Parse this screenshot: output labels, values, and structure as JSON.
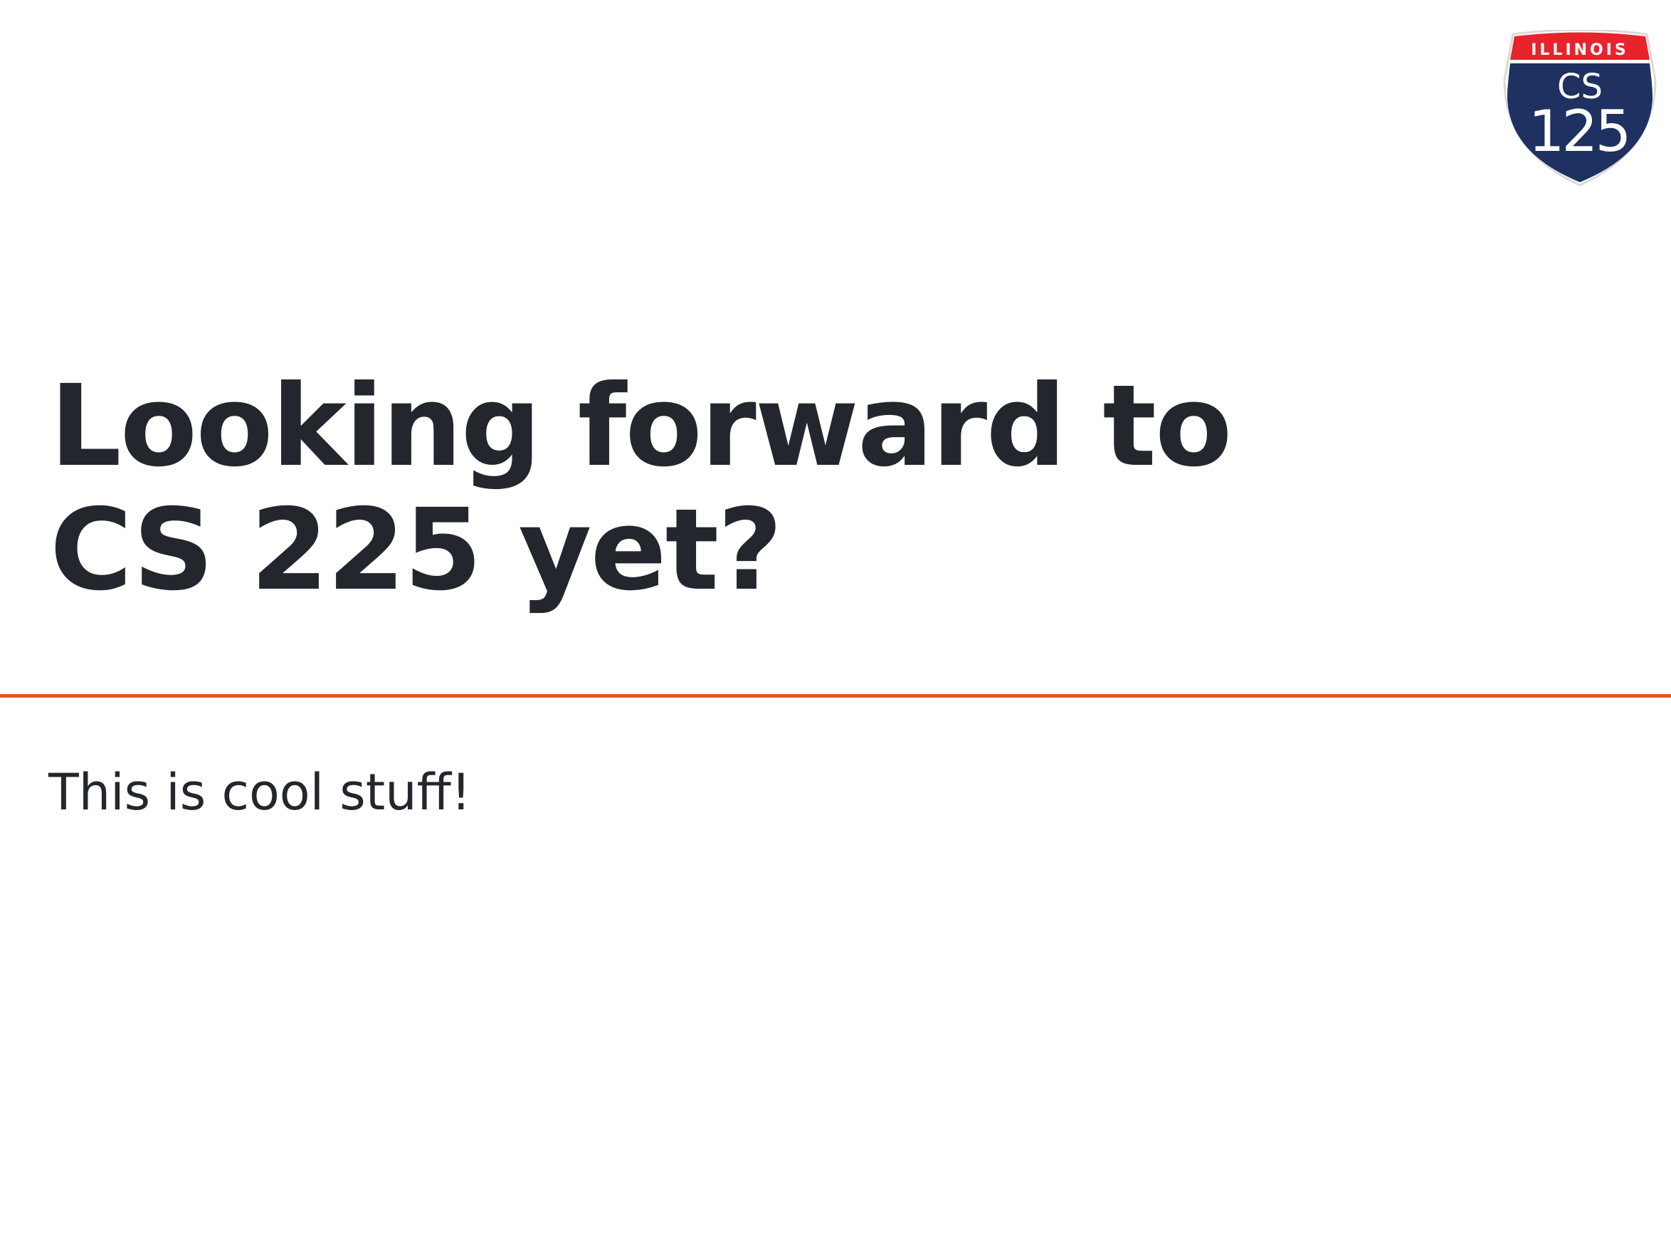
{
  "slide": {
    "title": "Looking forward to CS 225 yet?",
    "body": "This is cool stuff!"
  },
  "logo": {
    "banner": "ILLINOIS",
    "line1": "CS",
    "line2": "125",
    "colors": {
      "banner": "#e8232c",
      "shield": "#1e3161",
      "text": "#ffffff"
    }
  },
  "colors": {
    "text": "#23272d",
    "accent_rule": "#e0532f",
    "background": "#ffffff"
  }
}
